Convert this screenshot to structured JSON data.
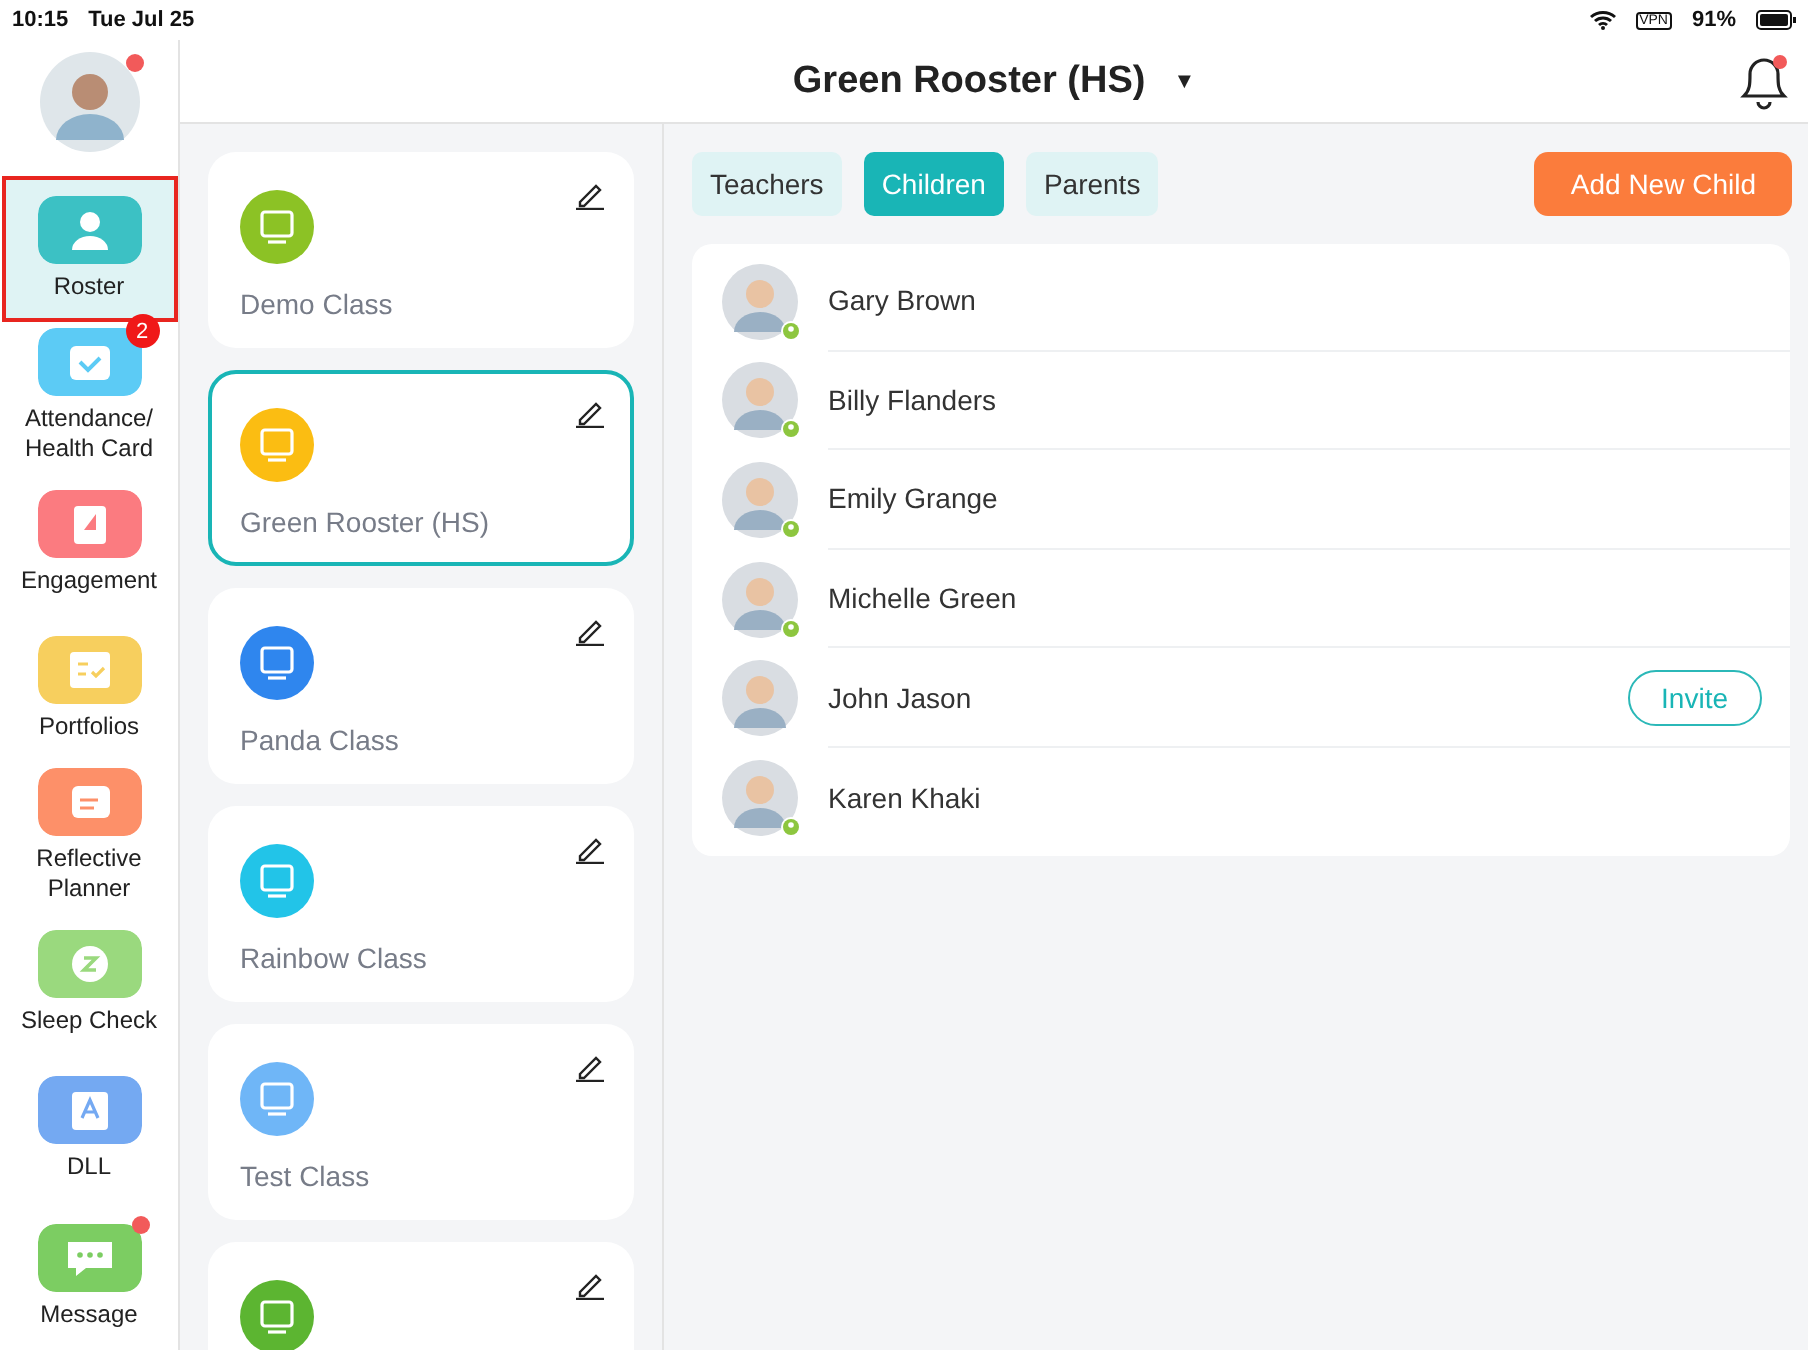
{
  "status_bar": {
    "time": "10:15",
    "date": "Tue Jul 25",
    "vpn": "VPN",
    "battery": "91%"
  },
  "profile": {
    "notification": true
  },
  "sidebar": {
    "items": [
      {
        "label": "Roster",
        "selected": true,
        "color": "#3cc1c4",
        "kind": "person"
      },
      {
        "label": "Attendance/ Health Card",
        "selected": false,
        "color": "#5ccbf5",
        "kind": "calendar",
        "badge": "2"
      },
      {
        "label": "Engagement",
        "selected": false,
        "color": "#fb7b80",
        "kind": "flag"
      },
      {
        "label": "Portfolios",
        "selected": false,
        "color": "#f7cf5e",
        "kind": "book"
      },
      {
        "label": "Reflective Planner",
        "selected": false,
        "color": "#fd9069",
        "kind": "planner"
      },
      {
        "label": "Sleep Check",
        "selected": false,
        "color": "#9ad97e",
        "kind": "clock"
      },
      {
        "label": "DLL",
        "selected": false,
        "color": "#74a9f2",
        "kind": "letter"
      },
      {
        "label": "Message",
        "selected": false,
        "color": "#7ccd62",
        "kind": "chat",
        "dot": true
      }
    ]
  },
  "header": {
    "title": "Green Rooster (HS)",
    "caret": "▼",
    "notification": true
  },
  "classes": [
    {
      "name": "Demo Class",
      "selected": false,
      "color": "#8cc225"
    },
    {
      "name": "Green Rooster (HS)",
      "selected": true,
      "color": "#fbbd12"
    },
    {
      "name": "Panda Class",
      "selected": false,
      "color": "#2f86ee"
    },
    {
      "name": "Rainbow Class",
      "selected": false,
      "color": "#22c4e8"
    },
    {
      "name": "Test Class",
      "selected": false,
      "color": "#6fb6f7"
    },
    {
      "selected": false,
      "color": "#5cb531"
    }
  ],
  "tabs": [
    {
      "label": "Teachers",
      "selected": false
    },
    {
      "label": "Children",
      "selected": true
    },
    {
      "label": "Parents",
      "selected": false
    }
  ],
  "add_button": "Add New Child",
  "children": [
    {
      "name": "Gary Brown",
      "linked": true
    },
    {
      "name": "Billy Flanders",
      "linked": true
    },
    {
      "name": "Emily Grange",
      "linked": true
    },
    {
      "name": "Michelle Green",
      "linked": true
    },
    {
      "name": "John Jason",
      "linked": false,
      "action": "Invite"
    },
    {
      "name": "Karen Khaki",
      "linked": true
    }
  ]
}
